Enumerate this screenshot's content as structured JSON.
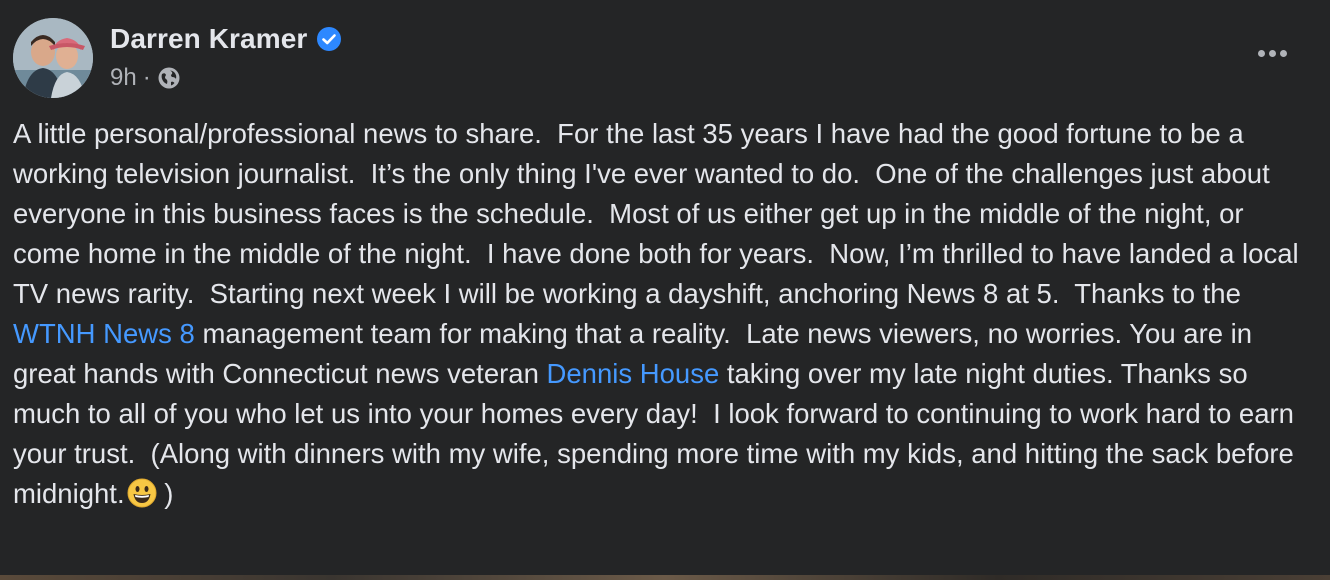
{
  "post": {
    "author": "Darren Kramer",
    "time": "9h",
    "separator": "·",
    "visibility_icon": "globe-icon",
    "verified_icon": "verified-badge-icon",
    "menu_icon": "more-options-icon",
    "body_parts": [
      "A little personal/professional news to share.  For the last 35 years I have had the good fortune to be a working television journalist.  It’s the only thing I've ever wanted to do.  One of the challenges just about everyone in this business faces is the schedule.  Most of us either get up in the middle of the night, or come home in the middle of the night.  I have done both for years.  Now, I’m thrilled to have landed a local TV news rarity.  Starting next week I will be working a dayshift, anchoring News 8 at 5.  Thanks to the ",
      "WTNH News 8",
      " management team for making that a reality.  Late news viewers, no worries. You are in great hands with Connecticut news veteran ",
      "Dennis House",
      " taking over my late night duties. Thanks so much to all of you who let us into your homes every day!  I look forward to continuing to work hard to earn your trust.  (Along with dinners with my wife, spending more time with my kids, and hitting the sack before midnight.",
      " )"
    ],
    "emoji": "grinning-face-emoji"
  },
  "colors": {
    "background": "#242526",
    "text": "#e4e6eb",
    "secondary_text": "#b0b3b8",
    "link": "#4599ff",
    "verified": "#2d88ff"
  }
}
